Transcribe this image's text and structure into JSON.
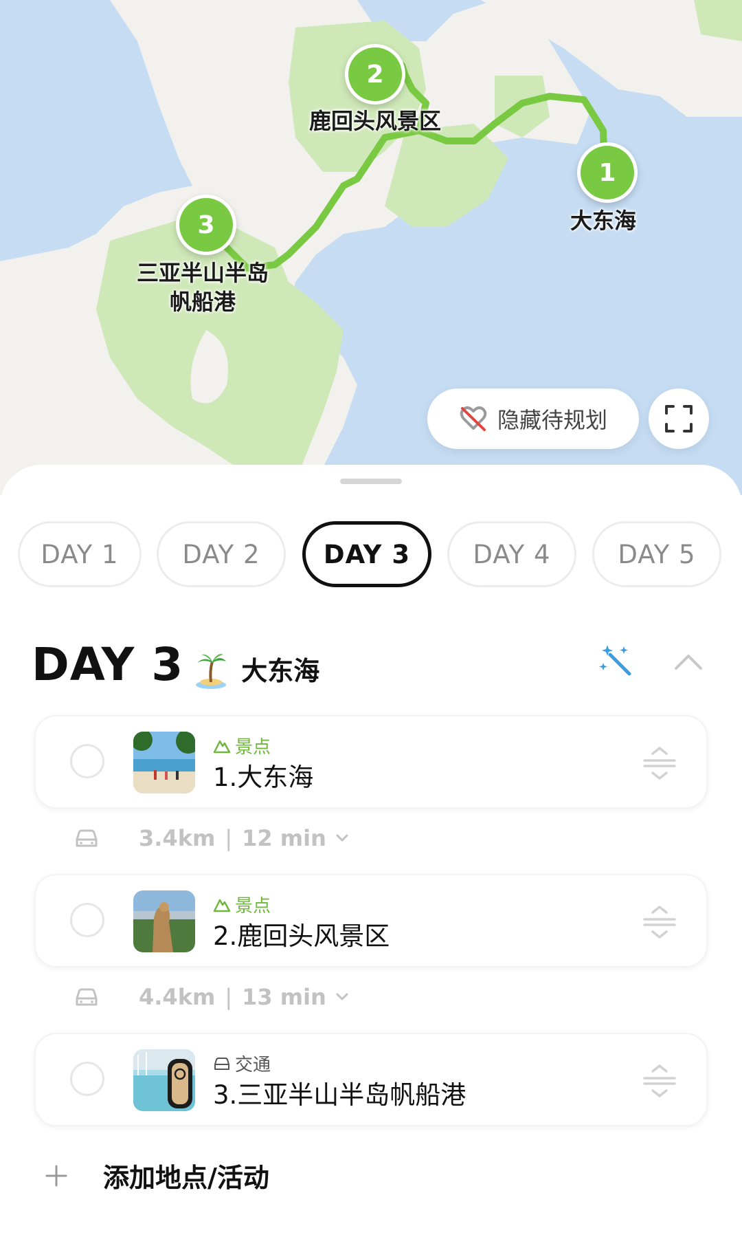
{
  "map": {
    "pins": [
      {
        "number": "1",
        "label": "大东海"
      },
      {
        "number": "2",
        "label": "鹿回头风景区"
      },
      {
        "number": "3",
        "label_line1": "三亚半山半岛",
        "label_line2": "帆船港"
      }
    ],
    "hide_button_label": "隐藏待规划",
    "colors": {
      "water": "#c5dcf3",
      "land": "#f2f1ee",
      "park": "#cfe8b8",
      "route": "#7ac943"
    }
  },
  "tabs": [
    "DAY 1",
    "DAY 2",
    "DAY 3",
    "DAY 4",
    "DAY 5"
  ],
  "active_tab": "DAY 3",
  "day_header": {
    "title": "DAY 3",
    "emoji": "island-palm-icon",
    "subtitle": "大东海"
  },
  "items": [
    {
      "category": "景点",
      "category_icon": "mountain-icon",
      "name": "1.大东海"
    },
    {
      "category": "景点",
      "category_icon": "mountain-icon",
      "name": "2.鹿回头风景区"
    },
    {
      "category": "交通",
      "category_icon": "car-icon",
      "name": "3.三亚半山半岛帆船港"
    }
  ],
  "routes": [
    {
      "distance": "3.4km",
      "duration": "12 min"
    },
    {
      "distance": "4.4km",
      "duration": "13 min"
    }
  ],
  "add_label": "添加地点/活动"
}
